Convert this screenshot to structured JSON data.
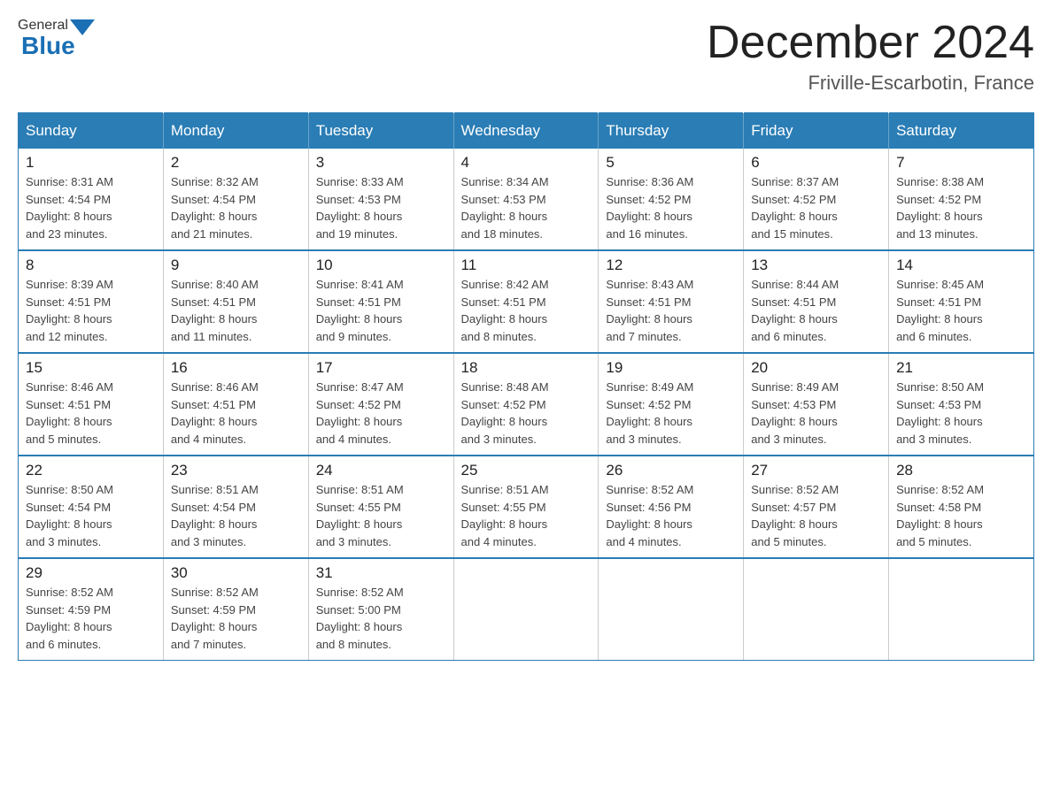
{
  "header": {
    "logo_general": "General",
    "logo_blue": "Blue",
    "month_title": "December 2024",
    "location": "Friville-Escarbotin, France"
  },
  "days_of_week": [
    "Sunday",
    "Monday",
    "Tuesday",
    "Wednesday",
    "Thursday",
    "Friday",
    "Saturday"
  ],
  "weeks": [
    [
      {
        "day": "1",
        "sunrise": "8:31 AM",
        "sunset": "4:54 PM",
        "daylight": "8 hours and 23 minutes."
      },
      {
        "day": "2",
        "sunrise": "8:32 AM",
        "sunset": "4:54 PM",
        "daylight": "8 hours and 21 minutes."
      },
      {
        "day": "3",
        "sunrise": "8:33 AM",
        "sunset": "4:53 PM",
        "daylight": "8 hours and 19 minutes."
      },
      {
        "day": "4",
        "sunrise": "8:34 AM",
        "sunset": "4:53 PM",
        "daylight": "8 hours and 18 minutes."
      },
      {
        "day": "5",
        "sunrise": "8:36 AM",
        "sunset": "4:52 PM",
        "daylight": "8 hours and 16 minutes."
      },
      {
        "day": "6",
        "sunrise": "8:37 AM",
        "sunset": "4:52 PM",
        "daylight": "8 hours and 15 minutes."
      },
      {
        "day": "7",
        "sunrise": "8:38 AM",
        "sunset": "4:52 PM",
        "daylight": "8 hours and 13 minutes."
      }
    ],
    [
      {
        "day": "8",
        "sunrise": "8:39 AM",
        "sunset": "4:51 PM",
        "daylight": "8 hours and 12 minutes."
      },
      {
        "day": "9",
        "sunrise": "8:40 AM",
        "sunset": "4:51 PM",
        "daylight": "8 hours and 11 minutes."
      },
      {
        "day": "10",
        "sunrise": "8:41 AM",
        "sunset": "4:51 PM",
        "daylight": "8 hours and 9 minutes."
      },
      {
        "day": "11",
        "sunrise": "8:42 AM",
        "sunset": "4:51 PM",
        "daylight": "8 hours and 8 minutes."
      },
      {
        "day": "12",
        "sunrise": "8:43 AM",
        "sunset": "4:51 PM",
        "daylight": "8 hours and 7 minutes."
      },
      {
        "day": "13",
        "sunrise": "8:44 AM",
        "sunset": "4:51 PM",
        "daylight": "8 hours and 6 minutes."
      },
      {
        "day": "14",
        "sunrise": "8:45 AM",
        "sunset": "4:51 PM",
        "daylight": "8 hours and 6 minutes."
      }
    ],
    [
      {
        "day": "15",
        "sunrise": "8:46 AM",
        "sunset": "4:51 PM",
        "daylight": "8 hours and 5 minutes."
      },
      {
        "day": "16",
        "sunrise": "8:46 AM",
        "sunset": "4:51 PM",
        "daylight": "8 hours and 4 minutes."
      },
      {
        "day": "17",
        "sunrise": "8:47 AM",
        "sunset": "4:52 PM",
        "daylight": "8 hours and 4 minutes."
      },
      {
        "day": "18",
        "sunrise": "8:48 AM",
        "sunset": "4:52 PM",
        "daylight": "8 hours and 3 minutes."
      },
      {
        "day": "19",
        "sunrise": "8:49 AM",
        "sunset": "4:52 PM",
        "daylight": "8 hours and 3 minutes."
      },
      {
        "day": "20",
        "sunrise": "8:49 AM",
        "sunset": "4:53 PM",
        "daylight": "8 hours and 3 minutes."
      },
      {
        "day": "21",
        "sunrise": "8:50 AM",
        "sunset": "4:53 PM",
        "daylight": "8 hours and 3 minutes."
      }
    ],
    [
      {
        "day": "22",
        "sunrise": "8:50 AM",
        "sunset": "4:54 PM",
        "daylight": "8 hours and 3 minutes."
      },
      {
        "day": "23",
        "sunrise": "8:51 AM",
        "sunset": "4:54 PM",
        "daylight": "8 hours and 3 minutes."
      },
      {
        "day": "24",
        "sunrise": "8:51 AM",
        "sunset": "4:55 PM",
        "daylight": "8 hours and 3 minutes."
      },
      {
        "day": "25",
        "sunrise": "8:51 AM",
        "sunset": "4:55 PM",
        "daylight": "8 hours and 4 minutes."
      },
      {
        "day": "26",
        "sunrise": "8:52 AM",
        "sunset": "4:56 PM",
        "daylight": "8 hours and 4 minutes."
      },
      {
        "day": "27",
        "sunrise": "8:52 AM",
        "sunset": "4:57 PM",
        "daylight": "8 hours and 5 minutes."
      },
      {
        "day": "28",
        "sunrise": "8:52 AM",
        "sunset": "4:58 PM",
        "daylight": "8 hours and 5 minutes."
      }
    ],
    [
      {
        "day": "29",
        "sunrise": "8:52 AM",
        "sunset": "4:59 PM",
        "daylight": "8 hours and 6 minutes."
      },
      {
        "day": "30",
        "sunrise": "8:52 AM",
        "sunset": "4:59 PM",
        "daylight": "8 hours and 7 minutes."
      },
      {
        "day": "31",
        "sunrise": "8:52 AM",
        "sunset": "5:00 PM",
        "daylight": "8 hours and 8 minutes."
      },
      null,
      null,
      null,
      null
    ]
  ],
  "labels": {
    "sunrise": "Sunrise:",
    "sunset": "Sunset:",
    "daylight": "Daylight:"
  }
}
